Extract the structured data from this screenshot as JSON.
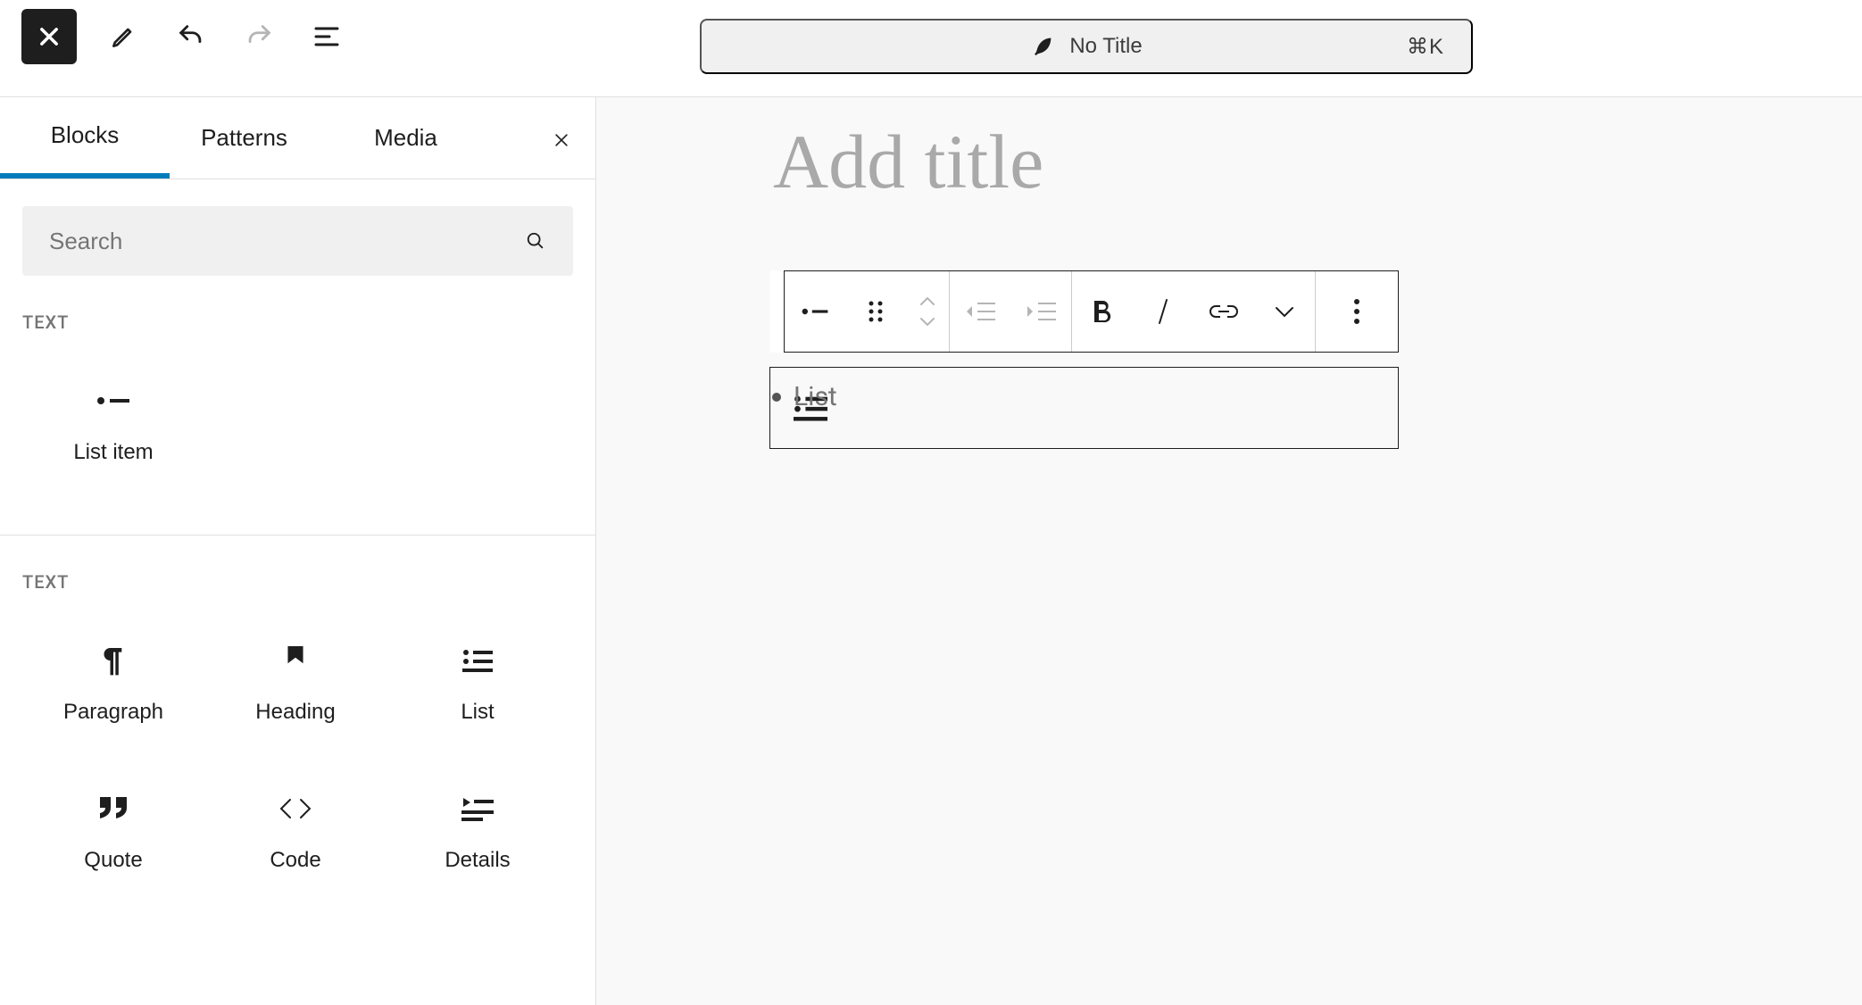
{
  "topbar": {
    "title": "No Title",
    "shortcut": "⌘K"
  },
  "inserter": {
    "tabs": {
      "blocks": "Blocks",
      "patterns": "Patterns",
      "media": "Media"
    },
    "search_placeholder": "Search",
    "section_heading_1": "TEXT",
    "section1": {
      "list_item": "List item"
    },
    "section_heading_2": "TEXT",
    "section2": {
      "paragraph": "Paragraph",
      "heading": "Heading",
      "list": "List",
      "quote": "Quote",
      "code": "Code",
      "details": "Details"
    }
  },
  "editor": {
    "title_placeholder": "Add title",
    "list_placeholder": "List"
  }
}
